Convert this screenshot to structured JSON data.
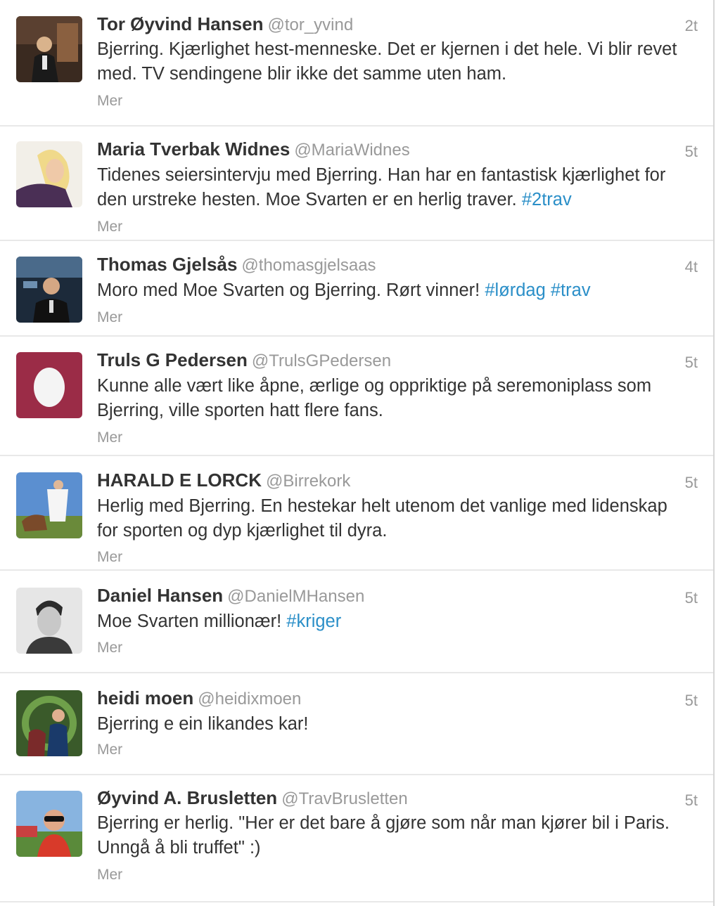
{
  "tweets": [
    {
      "name": "Tor Øyvind Hansen",
      "handle": "@tor_yvind",
      "time": "2t",
      "text": "Bjerring. Kjærlighet hest-menneske. Det er kjernen i det hele. Vi blir revet med. TV sendingene blir ikke det samme uten ham.",
      "hashtags": [],
      "more": "Mer",
      "avatar_icon": "user-photo-icon"
    },
    {
      "name": "Maria Tverbak Widnes",
      "handle": "@MariaWidnes",
      "time": "5t",
      "text": "Tidenes seiersintervju med Bjerring. Han har en fantastisk kjærlighet for den urstreke hesten. Moe Svarten er en herlig traver.",
      "hashtags": [
        "#2trav"
      ],
      "more": "Mer",
      "avatar_icon": "user-photo-icon"
    },
    {
      "name": "Thomas Gjelsås",
      "handle": "@thomasgjelsaas",
      "time": "4t",
      "text": "Moro med Moe Svarten og Bjerring. Rørt vinner!",
      "hashtags": [
        "#lørdag",
        "#trav"
      ],
      "more": "Mer",
      "avatar_icon": "user-photo-icon"
    },
    {
      "name": "Truls G Pedersen",
      "handle": "@TrulsGPedersen",
      "time": "5t",
      "text": "Kunne alle vært like åpne, ærlige og oppriktige på seremoniplass som Bjerring, ville sporten hatt flere fans.",
      "hashtags": [],
      "more": "Mer",
      "avatar_icon": "default-egg-icon"
    },
    {
      "name": "HARALD E LORCK",
      "handle": "@Birrekork",
      "time": "5t",
      "text": "Herlig med Bjerring. En hestekar helt utenom det vanlige med lidenskap for sporten og dyp kjærlighet til dyra.",
      "hashtags": [],
      "more": "Mer",
      "avatar_icon": "user-photo-icon"
    },
    {
      "name": "Daniel Hansen",
      "handle": "@DanielMHansen",
      "time": "5t",
      "text": "Moe Svarten millionær!",
      "hashtags": [
        "#kriger"
      ],
      "more": "Mer",
      "avatar_icon": "user-photo-icon"
    },
    {
      "name": "heidi moen",
      "handle": "@heidixmoen",
      "time": "5t",
      "text": "Bjerring e ein likandes kar!",
      "hashtags": [],
      "more": "Mer",
      "avatar_icon": "user-photo-icon"
    },
    {
      "name": "Øyvind A. Brusletten",
      "handle": "@TravBrusletten",
      "time": "5t",
      "text": "Bjerring er herlig. \"Her er det bare å gjøre som når man kjører bil i Paris. Unngå å bli truffet\" :)",
      "hashtags": [],
      "more": "Mer",
      "avatar_icon": "user-photo-icon"
    }
  ],
  "colors": {
    "hashtag": "#2b8fc8",
    "meta": "#999999",
    "text": "#333333",
    "egg_bg": "#9b2c47"
  }
}
